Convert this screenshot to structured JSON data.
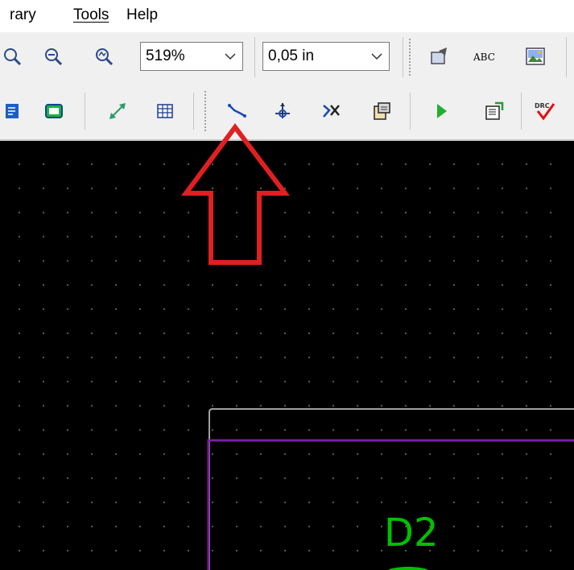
{
  "menu": {
    "library": "rary",
    "tools": "Tools",
    "help": "Help"
  },
  "toolbar": {
    "zoom_level": "519%",
    "grid_size": "0,05 in",
    "text_tool_label": "ABC",
    "drc_label": "DRC"
  },
  "canvas": {
    "component_reference": "D2",
    "background_color": "#000000",
    "grid_dot_color": "#5a5a5a",
    "board_outline_color": "#a0a0a0",
    "courtyard_color": "#7a1fa0",
    "silkscreen_color": "#00c000"
  },
  "annotation": {
    "arrow_color": "#e02020",
    "points_to": "route-track-tool"
  },
  "icons": [
    "zoom-in-icon",
    "zoom-out-icon",
    "zoom-fit-icon",
    "module-editor-icon",
    "text-icon",
    "image-icon",
    "net-inspector-icon",
    "board-icon",
    "measure-icon",
    "grid-icon",
    "route-track-icon",
    "add-via-icon",
    "delete-track-icon",
    "module-properties-icon",
    "run-icon",
    "export-icon",
    "drc-icon"
  ]
}
